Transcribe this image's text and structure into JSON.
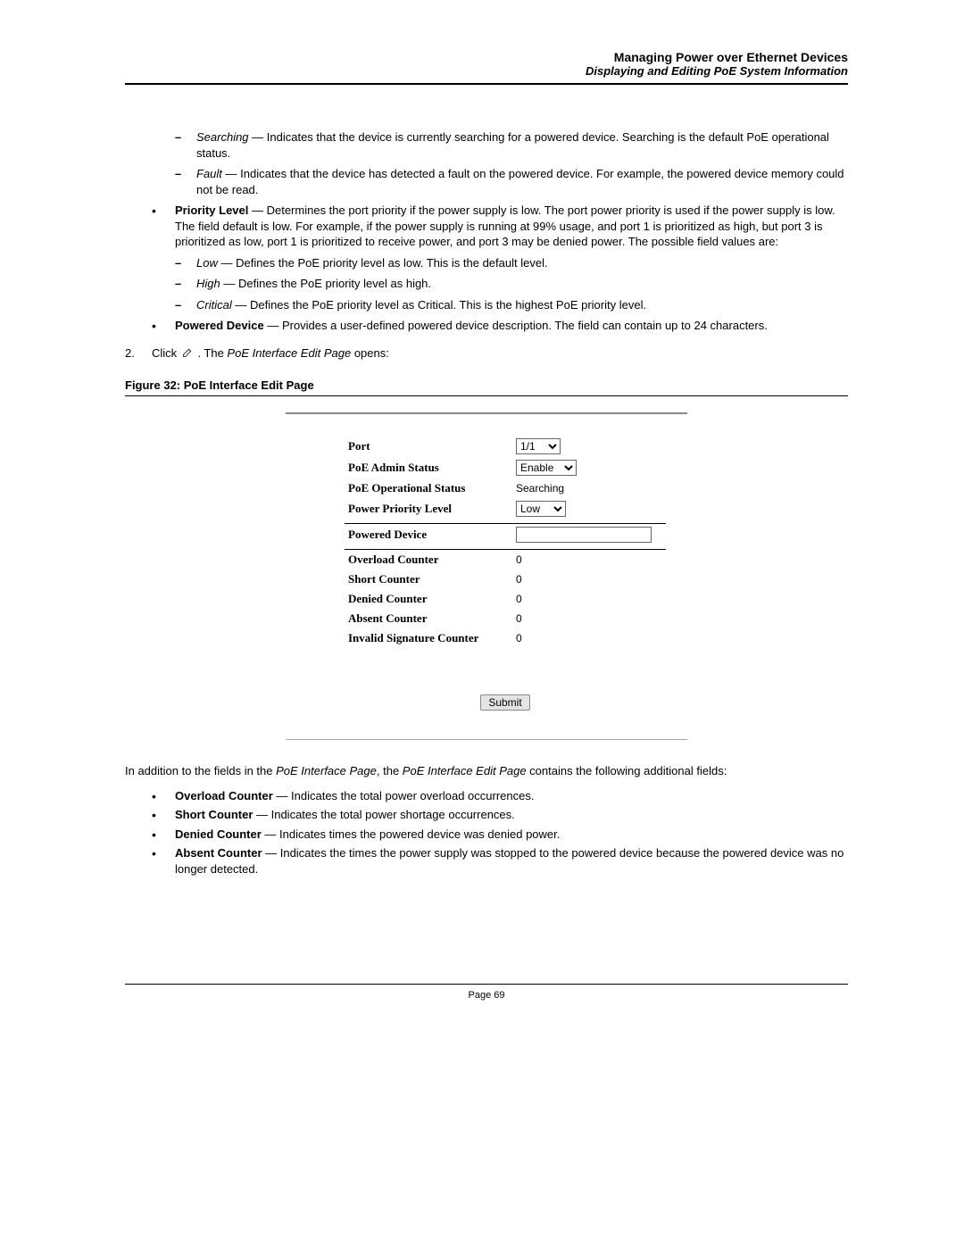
{
  "header": {
    "title": "Managing Power over Ethernet Devices",
    "subtitle": "Displaying and Editing PoE System Information"
  },
  "topDash": [
    {
      "term": "Searching",
      "desc": " — Indicates that the device is currently searching for a powered device. Searching is the default PoE operational status."
    },
    {
      "term": "Fault",
      "desc": " — Indicates that the device has detected a fault on the powered device. For example, the powered device memory could not be read."
    }
  ],
  "priority": {
    "term": "Priority Level",
    "desc": " — Determines the port priority if the power supply is low. The port power priority is used if the power supply is low. The field default is low. For example, if the power supply is running at 99% usage, and port 1 is prioritized as high, but port 3 is prioritized as low, port 1 is prioritized to receive power, and port 3 may be denied power. The possible field values are:"
  },
  "priorityLevels": [
    {
      "term": "Low",
      "desc": " — Defines the PoE priority level as low. This is the default level."
    },
    {
      "term": "High",
      "desc": " — Defines the PoE priority level as high."
    },
    {
      "term": "Critical",
      "desc": " — Defines the PoE priority level as Critical. This is the highest PoE priority level."
    }
  ],
  "poweredDevice": {
    "term": "Powered Device",
    "desc": " — Provides a user-defined powered device description. The field can contain up to 24 characters."
  },
  "step": {
    "num": "2.",
    "prefix": "Click  ",
    "mid": " . The ",
    "page": "PoE Interface Edit Page",
    "suffix": " opens:"
  },
  "figureCaption": "Figure 32:  PoE Interface Edit Page",
  "form": {
    "port_label": "Port",
    "port_value": "1/1",
    "admin_label": "PoE Admin Status",
    "admin_value": "Enable",
    "oper_label": "PoE Operational Status",
    "oper_value": "Searching",
    "prio_label": "Power Priority Level",
    "prio_value": "Low",
    "pd_label": "Powered Device",
    "pd_value": "",
    "overload_label": "Overload Counter",
    "overload_value": "0",
    "short_label": "Short Counter",
    "short_value": "0",
    "denied_label": "Denied Counter",
    "denied_value": "0",
    "absent_label": "Absent Counter",
    "absent_value": "0",
    "invsig_label": "Invalid Signature Counter",
    "invsig_value": "0",
    "submit": "Submit"
  },
  "afterFig": {
    "p1a": "In addition to the fields in the ",
    "p1b": "PoE Interface Page",
    "p1c": ", the ",
    "p1d": "PoE Interface Edit Page",
    "p1e": " contains the following additional fields:"
  },
  "counters": [
    {
      "term": "Overload Counter",
      "desc": " — Indicates the total power overload occurrences."
    },
    {
      "term": "Short Counter",
      "desc": " — Indicates the total power shortage occurrences."
    },
    {
      "term": "Denied Counter",
      "desc": " — Indicates times the powered device was denied power."
    },
    {
      "term": "Absent Counter",
      "desc": " — Indicates the times the power supply was stopped to the powered device because the powered device was no longer detected."
    }
  ],
  "footer": "Page 69"
}
